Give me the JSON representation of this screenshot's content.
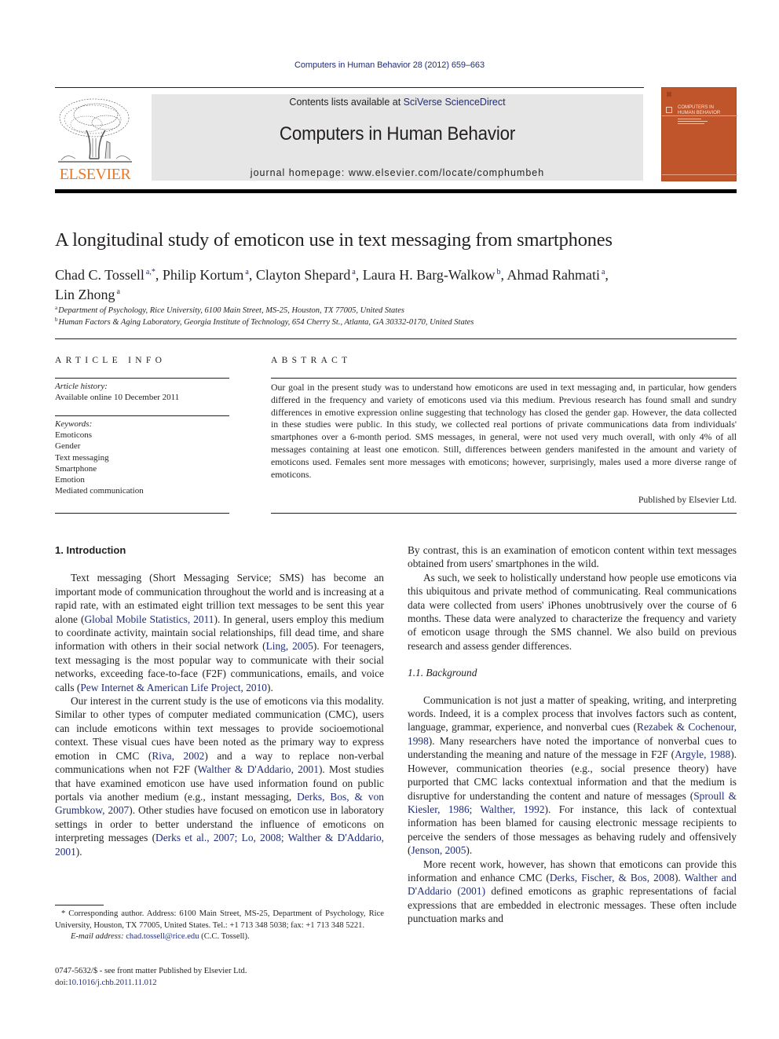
{
  "running_head": "Computers in Human Behavior 28 (2012) 659–663",
  "masthead": {
    "contents_prefix": "Contents lists available at ",
    "contents_link": "SciVerse ScienceDirect",
    "journal_title": "Computers in Human Behavior",
    "homepage_prefix": "journal homepage: ",
    "homepage_url": "www.elsevier.com/locate/comphumbeh",
    "publisher_logo_text": "ELSEVIER",
    "cover_title_line1": "COMPUTERS IN",
    "cover_title_line2": "HUMAN BEHAVIOR",
    "colors": {
      "publisher_orange": "#e87722",
      "cover": "#c0542a",
      "link_blue": "#1f2d7a",
      "masthead_bg": "#e6e6e6"
    }
  },
  "article": {
    "title": "A longitudinal study of emoticon use in text messaging from smartphones",
    "authors": [
      {
        "name": "Chad C. Tossell",
        "sup": "a,*",
        "sep": ", "
      },
      {
        "name": "Philip Kortum",
        "sup": "a",
        "sep": ", "
      },
      {
        "name": "Clayton Shepard",
        "sup": "a",
        "sep": ", "
      },
      {
        "name": "Laura H. Barg-Walkow",
        "sup": "b",
        "sep": ", "
      },
      {
        "name": "Ahmad Rahmati",
        "sup": "a",
        "sep": ","
      },
      {
        "name": "Lin Zhong",
        "sup": "a",
        "sep": ""
      }
    ],
    "affiliations": [
      {
        "mark": "a",
        "text": "Department of Psychology, Rice University, 6100 Main Street, MS-25, Houston, TX 77005, United States"
      },
      {
        "mark": "b",
        "text": "Human Factors & Aging Laboratory, Georgia Institute of Technology, 654 Cherry St., Atlanta, GA 30332-0170, United States"
      }
    ]
  },
  "article_info": {
    "heading": "ARTICLE INFO",
    "history_label": "Article history:",
    "history_value": "Available online 10 December 2011",
    "keywords_label": "Keywords:",
    "keywords": [
      "Emoticons",
      "Gender",
      "Text messaging",
      "Smartphone",
      "Emotion",
      "Mediated communication"
    ]
  },
  "abstract": {
    "heading": "ABSTRACT",
    "text": "Our goal in the present study was to understand how emoticons are used in text messaging and, in particular, how genders differed in the frequency and variety of emoticons used via this medium. Previous research has found small and sundry differences in emotive expression online suggesting that technology has closed the gender gap. However, the data collected in these studies were public. In this study, we collected real portions of private communications data from individuals' smartphones over a 6-month period. SMS messages, in general, were not used very much overall, with only 4% of all messages containing at least one emoticon. Still, differences between genders manifested in the amount and variety of emoticons used. Females sent more messages with emoticons; however, surprisingly, males used a more diverse range of emoticons.",
    "published_by": "Published by Elsevier Ltd."
  },
  "body": {
    "section1_heading": "1. Introduction",
    "p1": {
      "t1": "Text messaging (Short Messaging Service; SMS) has become an important mode of communication throughout the world and is increasing at a rapid rate, with an estimated eight trillion text messages to be sent this year alone (",
      "c1": "Global Mobile Statistics, 2011",
      "t2": "). In general, users employ this medium to coordinate activity, maintain social relationships, fill dead time, and share information with others in their social network (",
      "c2": "Ling, 2005",
      "t3": "). For teenagers, text messaging is the most popular way to communicate with their social networks, exceeding face-to-face (F2F) communications, emails, and voice calls (",
      "c3": "Pew Internet & American Life Project, 2010",
      "t4": ")."
    },
    "p2": {
      "t1": "Our interest in the current study is the use of emoticons via this modality. Similar to other types of computer mediated communication (CMC), users can include emoticons within text messages to provide socioemotional context. These visual cues have been noted as the primary way to express emotion in CMC (",
      "c1": "Riva, 2002",
      "t2": ") and a way to replace non-verbal communications when not F2F (",
      "c2": "Walther & D'Addario, 2001",
      "t3": "). Most studies that have examined emoticon use have used information found on public portals via another medium (e.g., instant messaging, ",
      "c3": "Derks, Bos, & von Grumbkow, 2007",
      "t4": "). Other studies have focused on emoticon use in laboratory settings in order to better understand the influence of emoticons on interpreting messages (",
      "c4": "Derks et al., 2007; Lo, 2008; Walther & D'Addario, 2001",
      "t5": ")."
    },
    "p3": "By contrast, this is an examination of emoticon content within text messages obtained from users' smartphones in the wild.",
    "p4": "As such, we seek to holistically understand how people use emoticons via this ubiquitous and private method of communicating. Real communications data were collected from users' iPhones unobtrusively over the course of 6 months. These data were analyzed to characterize the frequency and variety of emoticon usage through the SMS channel. We also build on previous research and assess gender differences.",
    "subsection_heading": "1.1. Background",
    "p5": {
      "t1": "Communication is not just a matter of speaking, writing, and interpreting words. Indeed, it is a complex process that involves factors such as content, language, grammar, experience, and nonverbal cues (",
      "c1": "Rezabek & Cochenour, 1998",
      "t2": "). Many researchers have noted the importance of nonverbal cues to understanding the meaning and nature of the message in F2F (",
      "c2": "Argyle, 1988",
      "t3": "). However, communication theories (e.g., social presence theory) have purported that CMC lacks contextual information and that the medium is disruptive for understanding the content and nature of messages (",
      "c3": "Sproull & Kiesler, 1986; Walther, 1992",
      "t4": "). For instance, this lack of contextual information has been blamed for causing electronic message recipients to perceive the senders of those messages as behaving rudely and offensively (",
      "c4": "Jenson, 2005",
      "t5": ")."
    },
    "p6": {
      "t1": "More recent work, however, has shown that emoticons can provide this information and enhance CMC (",
      "c1": "Derks, Fischer, & Bos, 2008",
      "t2": "). ",
      "c2": "Walther and D'Addario (2001)",
      "t3": " defined emoticons as graphic representations of facial expressions that are embedded in electronic messages. These often include punctuation marks and"
    }
  },
  "footnote": {
    "star": "*",
    "corresponding": " Corresponding author. Address: 6100 Main Street, MS-25, Department of Psychology, Rice University, Houston, TX 77005, United States. Tel.: +1 713 348 5038; fax: +1 713 348 5221.",
    "email_label": "E-mail address: ",
    "email": "chad.tossell@rice.edu",
    "email_suffix": " (C.C. Tossell)."
  },
  "front_matter": {
    "issn_line": "0747-5632/$ - see front matter Published by Elsevier Ltd.",
    "doi_prefix": "doi:",
    "doi": "10.1016/j.chb.2011.11.012"
  }
}
